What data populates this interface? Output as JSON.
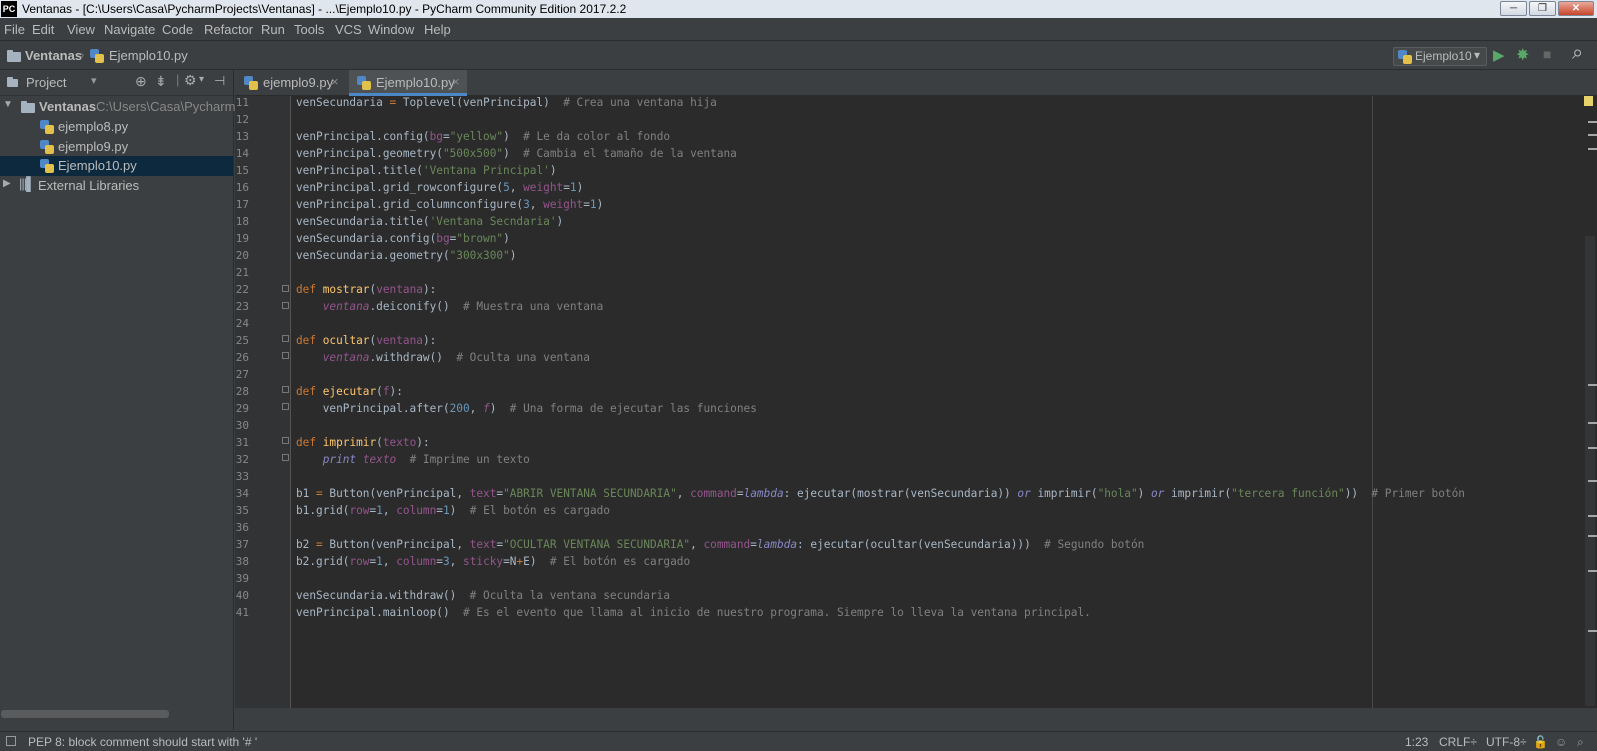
{
  "window": {
    "logo": "PC",
    "title": "Ventanas - [C:\\Users\\Casa\\PycharmProjects\\Ventanas] - ...\\Ejemplo10.py - PyCharm Community Edition 2017.2.2",
    "minimize": "─",
    "maximize": "❐",
    "close": "✕"
  },
  "menu": [
    "File",
    "Edit",
    "View",
    "Navigate",
    "Code",
    "Refactor",
    "Run",
    "Tools",
    "VCS",
    "Window",
    "Help"
  ],
  "breadcrumb": {
    "project": "Ventanas",
    "file": "Ejemplo10.py"
  },
  "run_config": {
    "label": "Ejemplo10",
    "arrow": "▾"
  },
  "toolbar_icons": {
    "run": "▶",
    "debug": "✸",
    "stop": "■",
    "search": "⌕"
  },
  "sidebar": {
    "title": "Project",
    "tree": [
      {
        "label": "Ventanas",
        "path": "C:\\Users\\Casa\\PycharmPr"
      },
      {
        "label": "ejemplo8.py"
      },
      {
        "label": "ejemplo9.py"
      },
      {
        "label": "Ejemplo10.py"
      },
      {
        "label": "External Libraries"
      }
    ]
  },
  "tabs": [
    {
      "label": "ejemplo9.py",
      "close": "×"
    },
    {
      "label": "Ejemplo10.py",
      "close": "×"
    }
  ],
  "editor": {
    "line_numbers": [
      "11",
      "12",
      "13",
      "14",
      "15",
      "16",
      "17",
      "18",
      "19",
      "20",
      "21",
      "22",
      "23",
      "24",
      "25",
      "26",
      "27",
      "28",
      "29",
      "30",
      "31",
      "32",
      "33",
      "34",
      "35",
      "36",
      "37",
      "38",
      "39",
      "40",
      "41"
    ]
  },
  "status": {
    "message": "PEP 8: block comment should start with '# '",
    "position": "1:23",
    "line_sep": "CRLF÷",
    "encoding": "UTF-8÷"
  },
  "colors": {
    "accent": "#4a88c7",
    "background": "#2b2b2b",
    "panel": "#3c3f41"
  }
}
